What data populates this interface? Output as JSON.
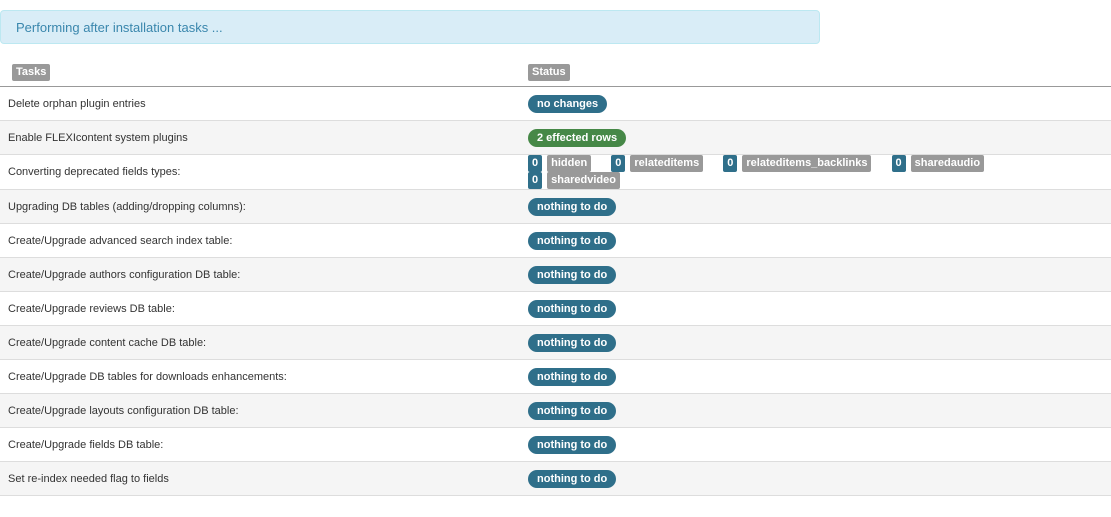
{
  "alert": {
    "text": "Performing after installation tasks ..."
  },
  "table": {
    "headers": {
      "tasks": "Tasks",
      "status": "Status"
    },
    "rows": [
      {
        "task": "Delete orphan plugin entries",
        "status": "no changes",
        "status_type": "info"
      },
      {
        "task": "Enable FLEXIcontent system plugins",
        "status": "2 effected rows",
        "status_type": "success"
      },
      {
        "task": "Converting deprecated fields types:",
        "fields": [
          {
            "count": "0",
            "name": "hidden"
          },
          {
            "count": "0",
            "name": "relateditems"
          },
          {
            "count": "0",
            "name": "relateditems_backlinks"
          },
          {
            "count": "0",
            "name": "sharedaudio"
          },
          {
            "count": "0",
            "name": "sharedvideo"
          }
        ]
      },
      {
        "task": "Upgrading DB tables (adding/dropping columns):",
        "status": "nothing to do",
        "status_type": "info"
      },
      {
        "task": "Create/Upgrade advanced search index table:",
        "status": "nothing to do",
        "status_type": "info"
      },
      {
        "task": "Create/Upgrade authors configuration DB table:",
        "status": "nothing to do",
        "status_type": "info"
      },
      {
        "task": "Create/Upgrade reviews DB table:",
        "status": "nothing to do",
        "status_type": "info"
      },
      {
        "task": "Create/Upgrade content cache DB table:",
        "status": "nothing to do",
        "status_type": "info"
      },
      {
        "task": "Create/Upgrade DB tables for downloads enhancements:",
        "status": "nothing to do",
        "status_type": "info"
      },
      {
        "task": "Create/Upgrade layouts configuration DB table:",
        "status": "nothing to do",
        "status_type": "info"
      },
      {
        "task": "Create/Upgrade fields DB table:",
        "status": "nothing to do",
        "status_type": "info"
      },
      {
        "task": "Set re-index needed flag to fields",
        "status": "nothing to do",
        "status_type": "info"
      }
    ]
  },
  "colors": {
    "info_badge": "#2f6f8a",
    "success_badge": "#468847",
    "header_label": "#999999",
    "alert_bg": "#d9edf7",
    "alert_text": "#3a87ad"
  }
}
